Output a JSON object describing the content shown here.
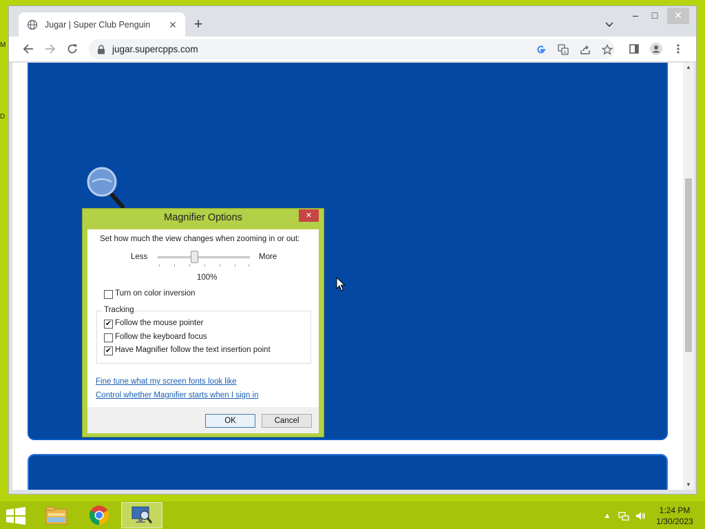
{
  "desktop": {
    "edge_label_top": "M",
    "edge_label_mid": "D"
  },
  "browser": {
    "tab_title": "Jugar | Super Club Penguin",
    "url": "jugar.supercpps.com",
    "window_controls": {
      "minimize": "–",
      "maximize": "□",
      "close": "✕"
    }
  },
  "dialog": {
    "title": "Magnifier Options",
    "close_glyph": "✕",
    "zoom_prompt": "Set how much the view changes when zooming in or out:",
    "slider_less": "Less",
    "slider_more": "More",
    "zoom_value": "100%",
    "zoom_value_percent": 100,
    "color_inversion_label": "Turn on color inversion",
    "color_inversion_checked": false,
    "tracking_label": "Tracking",
    "follow_mouse_label": "Follow the mouse pointer",
    "follow_mouse_checked": true,
    "follow_keyboard_label": "Follow the keyboard focus",
    "follow_keyboard_checked": false,
    "follow_text_label": "Have Magnifier follow the text insertion point",
    "follow_text_checked": true,
    "link_fonts": "Fine tune what my screen fonts look like",
    "link_startup": "Control whether Magnifier starts when I sign in",
    "ok_label": "OK",
    "cancel_label": "Cancel"
  },
  "taskbar": {
    "time": "1:24 PM",
    "date": "1/30/2023"
  },
  "colors": {
    "desktop_bg": "#b6d40c",
    "taskbar_bg": "#a6c409",
    "game_blue": "#0448a4",
    "dialog_frame": "#b3d046",
    "dialog_close": "#c74545",
    "link": "#1a5fb4"
  },
  "icons": {
    "tab_favicon": "globe-icon",
    "back": "arrow-left-icon",
    "forward": "arrow-right-icon",
    "reload": "reload-icon",
    "lock": "lock-icon",
    "google": "google-icon",
    "translate": "translate-icon",
    "share": "share-icon",
    "bookmark": "star-icon",
    "side_panel": "side-panel-icon",
    "profile": "profile-icon",
    "menu": "kebab-menu-icon"
  }
}
